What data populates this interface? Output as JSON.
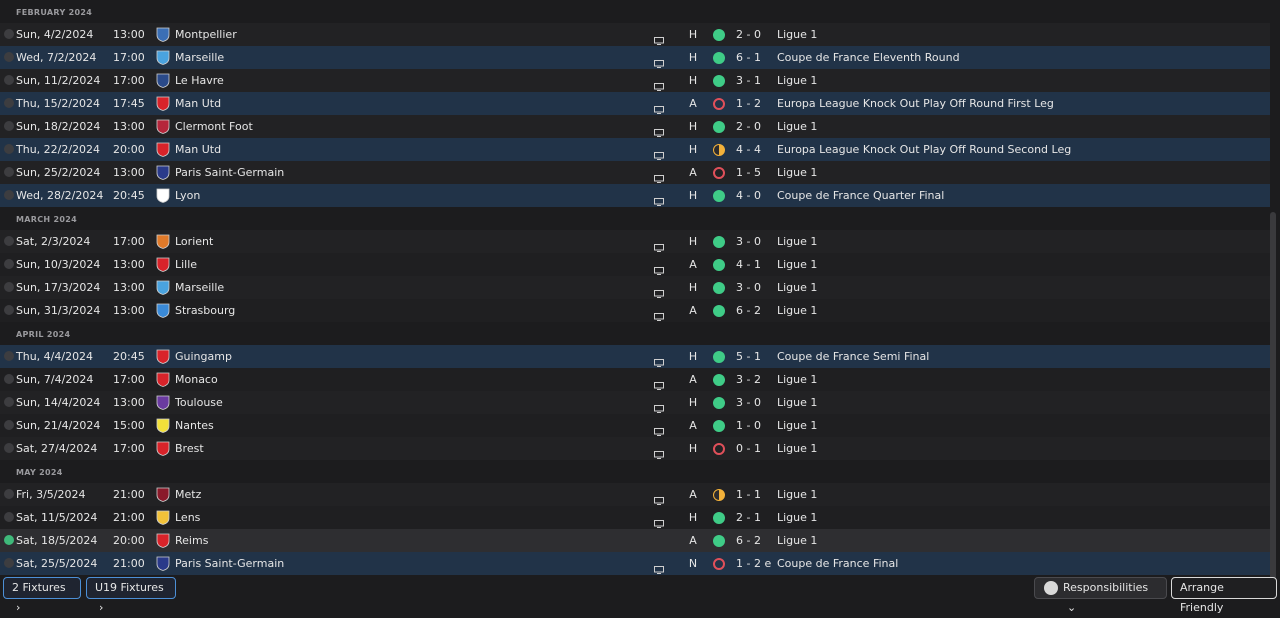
{
  "months": [
    {
      "name": "FEBRUARY 2024",
      "fixtures": [
        {
          "date": "Sun, 4/2/2024",
          "time": "13:00",
          "opponent": "Montpellier",
          "venue": "H",
          "result": "win",
          "score": "2 - 0",
          "competition": "Ligue 1",
          "cup": false,
          "tv": true
        },
        {
          "date": "Wed, 7/2/2024",
          "time": "17:00",
          "opponent": "Marseille",
          "venue": "H",
          "result": "win",
          "score": "6 - 1",
          "competition": "Coupe de France Eleventh Round",
          "cup": true,
          "tv": true
        },
        {
          "date": "Sun, 11/2/2024",
          "time": "17:00",
          "opponent": "Le Havre",
          "venue": "H",
          "result": "win",
          "score": "3 - 1",
          "competition": "Ligue 1",
          "cup": false,
          "tv": true
        },
        {
          "date": "Thu, 15/2/2024",
          "time": "17:45",
          "opponent": "Man Utd",
          "venue": "A",
          "result": "loss",
          "score": "1 - 2",
          "competition": "Europa League Knock Out Play Off Round First Leg",
          "cup": true,
          "tv": true
        },
        {
          "date": "Sun, 18/2/2024",
          "time": "13:00",
          "opponent": "Clermont Foot",
          "venue": "H",
          "result": "win",
          "score": "2 - 0",
          "competition": "Ligue 1",
          "cup": false,
          "tv": true
        },
        {
          "date": "Thu, 22/2/2024",
          "time": "20:00",
          "opponent": "Man Utd",
          "venue": "H",
          "result": "draw",
          "score": "4 - 4",
          "competition": "Europa League Knock Out Play Off Round Second Leg",
          "cup": true,
          "tv": true
        },
        {
          "date": "Sun, 25/2/2024",
          "time": "13:00",
          "opponent": "Paris Saint-Germain",
          "venue": "A",
          "result": "loss",
          "score": "1 - 5",
          "competition": "Ligue 1",
          "cup": false,
          "tv": true
        },
        {
          "date": "Wed, 28/2/2024",
          "time": "20:45",
          "opponent": "Lyon",
          "venue": "H",
          "result": "win",
          "score": "4 - 0",
          "competition": "Coupe de France Quarter Final",
          "cup": true,
          "tv": true
        }
      ]
    },
    {
      "name": "MARCH 2024",
      "fixtures": [
        {
          "date": "Sat, 2/3/2024",
          "time": "17:00",
          "opponent": "Lorient",
          "venue": "H",
          "result": "win",
          "score": "3 - 0",
          "competition": "Ligue 1",
          "cup": false,
          "tv": true
        },
        {
          "date": "Sun, 10/3/2024",
          "time": "13:00",
          "opponent": "Lille",
          "venue": "A",
          "result": "win",
          "score": "4 - 1",
          "competition": "Ligue 1",
          "cup": false,
          "tv": true
        },
        {
          "date": "Sun, 17/3/2024",
          "time": "13:00",
          "opponent": "Marseille",
          "venue": "H",
          "result": "win",
          "score": "3 - 0",
          "competition": "Ligue 1",
          "cup": false,
          "tv": true
        },
        {
          "date": "Sun, 31/3/2024",
          "time": "13:00",
          "opponent": "Strasbourg",
          "venue": "A",
          "result": "win",
          "score": "6 - 2",
          "competition": "Ligue 1",
          "cup": false,
          "tv": true
        }
      ]
    },
    {
      "name": "APRIL 2024",
      "fixtures": [
        {
          "date": "Thu, 4/4/2024",
          "time": "20:45",
          "opponent": "Guingamp",
          "venue": "H",
          "result": "win",
          "score": "5 - 1",
          "competition": "Coupe de France Semi Final",
          "cup": true,
          "tv": true
        },
        {
          "date": "Sun, 7/4/2024",
          "time": "17:00",
          "opponent": "Monaco",
          "venue": "A",
          "result": "win",
          "score": "3 - 2",
          "competition": "Ligue 1",
          "cup": false,
          "tv": true
        },
        {
          "date": "Sun, 14/4/2024",
          "time": "13:00",
          "opponent": "Toulouse",
          "venue": "H",
          "result": "win",
          "score": "3 - 0",
          "competition": "Ligue 1",
          "cup": false,
          "tv": true
        },
        {
          "date": "Sun, 21/4/2024",
          "time": "15:00",
          "opponent": "Nantes",
          "venue": "A",
          "result": "win",
          "score": "1 - 0",
          "competition": "Ligue 1",
          "cup": false,
          "tv": true
        },
        {
          "date": "Sat, 27/4/2024",
          "time": "17:00",
          "opponent": "Brest",
          "venue": "H",
          "result": "loss",
          "score": "0 - 1",
          "competition": "Ligue 1",
          "cup": false,
          "tv": true
        }
      ]
    },
    {
      "name": "MAY 2024",
      "fixtures": [
        {
          "date": "Fri, 3/5/2024",
          "time": "21:00",
          "opponent": "Metz",
          "venue": "A",
          "result": "draw",
          "score": "1 - 1",
          "competition": "Ligue 1",
          "cup": false,
          "tv": true
        },
        {
          "date": "Sat, 11/5/2024",
          "time": "21:00",
          "opponent": "Lens",
          "venue": "H",
          "result": "win",
          "score": "2 - 1",
          "competition": "Ligue 1",
          "cup": false,
          "tv": true
        },
        {
          "date": "Sat, 18/5/2024",
          "time": "20:00",
          "opponent": "Reims",
          "venue": "A",
          "result": "win",
          "score": "6 - 2",
          "competition": "Ligue 1",
          "cup": false,
          "tv": false,
          "selected": true
        },
        {
          "date": "Sat, 25/5/2024",
          "time": "21:00",
          "opponent": "Paris Saint-Germain",
          "venue": "N",
          "result": "loss",
          "score": "1 - 2 e",
          "competition": "Coupe de France Final",
          "cup": true,
          "tv": true
        }
      ]
    }
  ],
  "crests": {
    "Montpellier": "#3b6fb5",
    "Marseille": "#4aa3df",
    "Le Havre": "#2a4a8a",
    "Man Utd": "#d8232a",
    "Clermont Foot": "#b5263b",
    "Paris Saint-Germain": "#2a3a8a",
    "Lyon": "#ffffff",
    "Lorient": "#e07a2a",
    "Lille": "#d8232a",
    "Strasbourg": "#3a8ad8",
    "Guingamp": "#d8232a",
    "Monaco": "#d8232a",
    "Toulouse": "#6a3aa0",
    "Nantes": "#f2e03a",
    "Brest": "#d8232a",
    "Metz": "#8a1a2a",
    "Lens": "#f2c23a",
    "Reims": "#d8232a"
  },
  "buttons": {
    "fixtures": "2 Fixtures",
    "u19": "U19 Fixtures",
    "responsibilities": "Responsibilities",
    "arrange": "Arrange Friendly"
  },
  "icons": {
    "tv": "tv-icon",
    "chevron": "chevron-right-icon",
    "chevron_down": "chevron-down-icon"
  }
}
